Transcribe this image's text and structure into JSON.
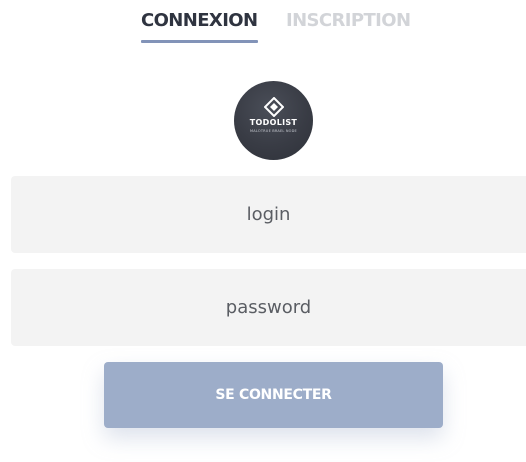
{
  "tabs": {
    "login_label": "CONNEXION",
    "signup_label": "INSCRIPTION",
    "active": "login"
  },
  "logo": {
    "icon": "diamond-logo-icon",
    "title": "TODOLIST",
    "tagline": "MALOTRUE BRAEL NODE"
  },
  "form": {
    "login_placeholder": "login",
    "password_placeholder": "password",
    "submit_label": "SE CONNECTER"
  },
  "colors": {
    "tab_active": "#2f3440",
    "tab_inactive": "#d2d4d8",
    "tab_underline": "#8293b8",
    "logo_bg": "#393c45",
    "field_bg": "#f3f3f3",
    "button_bg": "#9dadc9",
    "button_text": "#ffffff"
  }
}
